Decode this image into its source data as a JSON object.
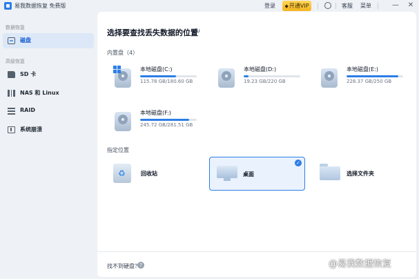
{
  "titlebar": {
    "app_title": "易我数据恢复 免费版",
    "login": "登录",
    "vip_icon": "◆",
    "vip_label": "开通VIP",
    "service": "客服",
    "menu": "菜单",
    "minimize": "—",
    "close": "✕"
  },
  "sidebar": {
    "section_data": "数据恢复",
    "section_advanced": "高级恢复",
    "items": [
      {
        "label": "磁盘",
        "icon": "disk-icon",
        "active": true
      },
      {
        "label": "SD 卡",
        "icon": "sd-card-icon"
      },
      {
        "label": "NAS 和 Linux",
        "icon": "nas-icon"
      },
      {
        "label": "RAID",
        "icon": "raid-icon"
      },
      {
        "label": "系统崩溃",
        "icon": "system-crash-icon"
      }
    ]
  },
  "main": {
    "title": "选择要查找丢失数据的位置",
    "refresh_icon": "↻",
    "internal_label": "内置盘（4）",
    "drives": [
      {
        "name": "本地磁盘(C:)",
        "size": "115.78 GB/180.60 GB",
        "used": 0.64,
        "system": true
      },
      {
        "name": "本地磁盘(D:)",
        "size": "19.23 GB/220 GB",
        "used": 0.09
      },
      {
        "name": "本地磁盘(E:)",
        "size": "228.37 GB/250 GB",
        "used": 0.91
      },
      {
        "name": "本地磁盘(F:)",
        "size": "245.72 GB/281.51 GB",
        "used": 0.87
      }
    ],
    "location_label": "指定位置",
    "locations": [
      {
        "label": "回收站",
        "icon": "recycle-bin-icon"
      },
      {
        "label": "桌面",
        "icon": "desktop-icon",
        "selected": true
      },
      {
        "label": "选择文件夹",
        "icon": "folder-icon"
      }
    ],
    "check_icon": "✓",
    "cant_find": "找不到硬盘？",
    "help_icon": "?"
  },
  "watermark": "@易我数据恢复",
  "colors": {
    "accent": "#2b7ee6",
    "vip": "#f5b41e",
    "selected_bg": "#eaf2fd"
  }
}
